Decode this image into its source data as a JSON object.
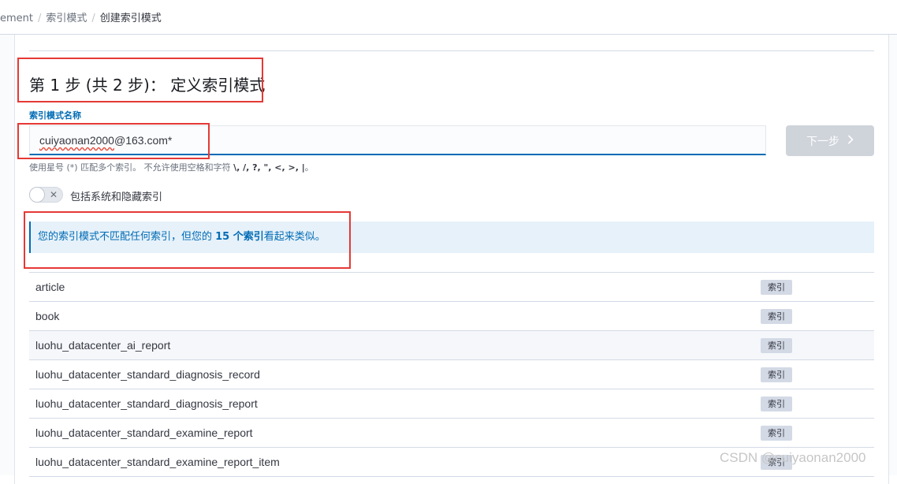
{
  "breadcrumb": {
    "items": [
      "ement",
      "索引模式",
      "创建索引模式"
    ]
  },
  "step_title": "第 1 步 (共 2 步)： 定义索引模式",
  "index_pattern": {
    "label": "索引模式名称",
    "value_underlined": "cuiyaonan2000",
    "value_rest": "@163.com*",
    "help_prefix": "使用星号 (*) 匹配多个索引。 不允许使用空格和字符 ",
    "help_chars": "\\, /, ?, \", <, >, |",
    "help_suffix": "。"
  },
  "next_button": {
    "label": "下一步",
    "enabled": false
  },
  "include_system_toggle": {
    "label": "包括系统和隐藏索引",
    "checked": false
  },
  "callout": {
    "prefix": "您的索引模式不匹配任何索引，但您的 ",
    "highlight": "15 个索引",
    "suffix": "看起来类似。"
  },
  "indices": [
    {
      "name": "article",
      "badge": "索引"
    },
    {
      "name": "book",
      "badge": "索引"
    },
    {
      "name": "luohu_datacenter_ai_report",
      "badge": "索引"
    },
    {
      "name": "luohu_datacenter_standard_diagnosis_record",
      "badge": "索引"
    },
    {
      "name": "luohu_datacenter_standard_diagnosis_report",
      "badge": "索引"
    },
    {
      "name": "luohu_datacenter_standard_examine_report",
      "badge": "索引"
    },
    {
      "name": "luohu_datacenter_standard_examine_report_item",
      "badge": "索引"
    }
  ],
  "watermark": "CSDN @cuiyaonan2000",
  "colors": {
    "accent": "#006bb4",
    "annotation_red": "#e53935",
    "callout_bg": "#e6f1fa"
  },
  "icons": {
    "next_button": "chevron-right-icon",
    "toggle": "cross-icon"
  }
}
